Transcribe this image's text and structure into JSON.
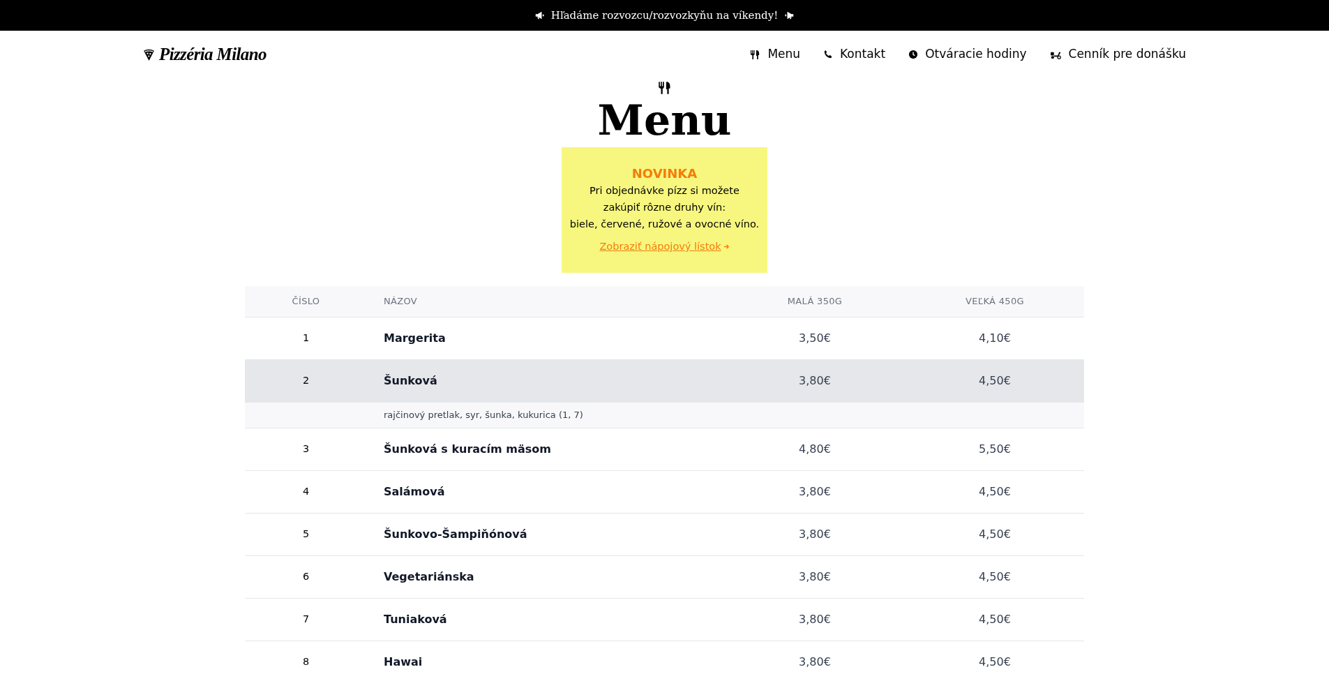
{
  "announcement": {
    "text": "Hľadáme rozvozcu/rozvozkyňu na víkendy!"
  },
  "header": {
    "logo": "Pizzéria Milano",
    "nav": [
      {
        "kind": "menu",
        "label": "Menu"
      },
      {
        "kind": "phone",
        "label": "Kontakt"
      },
      {
        "kind": "clock",
        "label": "Otváracie hodiny"
      },
      {
        "kind": "scooter",
        "label": "Cenník pre donášku"
      }
    ]
  },
  "page_title": "Menu",
  "notice": {
    "title": "NOVINKA",
    "lines": [
      "Pri objednávke pízz si možete",
      "zakúpiť rôzne druhy vín:",
      "biele, červené, ružové a ovocné víno."
    ],
    "link": "Zobraziť nápojový lístok"
  },
  "table": {
    "columns": [
      "ČÍSLO",
      "NÁZOV",
      "MALÁ 350G",
      "VEĽKÁ 450G"
    ],
    "rows": [
      {
        "number": "1",
        "name": "Margerita",
        "small": "3,50€",
        "large": "4,10€",
        "expanded": false
      },
      {
        "number": "2",
        "name": "Šunková",
        "small": "3,80€",
        "large": "4,50€",
        "expanded": true,
        "description": "rajčinový pretlak, syr, šunka, kukurica (1, 7)"
      },
      {
        "number": "3",
        "name": "Šunková s kuracím mäsom",
        "small": "4,80€",
        "large": "5,50€",
        "expanded": false
      },
      {
        "number": "4",
        "name": "Salámová",
        "small": "3,80€",
        "large": "4,50€",
        "expanded": false
      },
      {
        "number": "5",
        "name": "Šunkovo-Šampiňónová",
        "small": "3,80€",
        "large": "4,50€",
        "expanded": false
      },
      {
        "number": "6",
        "name": "Vegetariánska",
        "small": "3,80€",
        "large": "4,50€",
        "expanded": false
      },
      {
        "number": "7",
        "name": "Tuniaková",
        "small": "3,80€",
        "large": "4,50€",
        "expanded": false
      },
      {
        "number": "8",
        "name": "Hawai",
        "small": "3,80€",
        "large": "4,50€",
        "expanded": false
      }
    ]
  }
}
